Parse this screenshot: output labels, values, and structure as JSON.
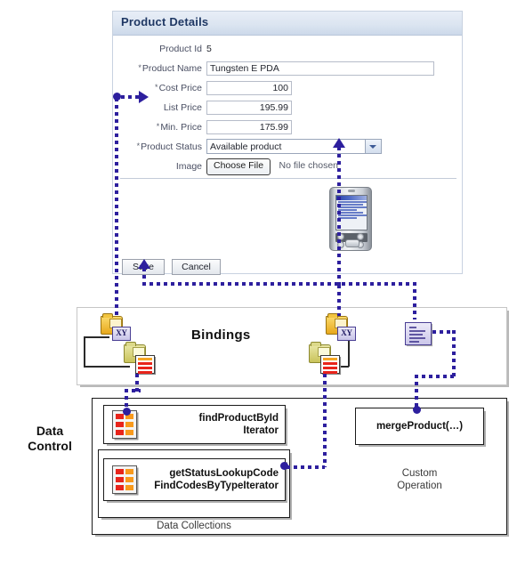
{
  "form": {
    "title": "Product Details",
    "fields": {
      "product_id": {
        "label": "Product Id",
        "value": "5",
        "required": false
      },
      "product_name": {
        "label": "Product Name",
        "value": "Tungsten E PDA",
        "required": true
      },
      "cost_price": {
        "label": "Cost Price",
        "value": "100",
        "required": true
      },
      "list_price": {
        "label": "List Price",
        "value": "195.99",
        "required": false
      },
      "min_price": {
        "label": "Min. Price",
        "value": "175.99",
        "required": true
      },
      "product_status": {
        "label": "Product Status",
        "value": "Available product",
        "required": true
      },
      "image": {
        "label": "Image",
        "button_label": "Choose File",
        "file_status": "No file chosen"
      }
    },
    "required_marker": "*",
    "buttons": {
      "save": "Save",
      "cancel": "Cancel"
    }
  },
  "bindings": {
    "label": "Bindings",
    "icons": {
      "attribute_binding_xy": "XY",
      "list_binding_xy": "XY"
    }
  },
  "data_control": {
    "label": "Data\nControl",
    "label_line1": "Data",
    "label_line2": "Control",
    "collections_label": "Data Collections",
    "custom_operation_label_line1": "Custom",
    "custom_operation_label_line2": "Operation",
    "nodes": [
      {
        "id": "find-product",
        "line1": "findProductById",
        "line2": "Iterator"
      },
      {
        "id": "status-lookup",
        "line1": "getStatusLookupCode",
        "line2": "FindCodesByTypeIterator"
      },
      {
        "id": "merge-product",
        "line1": "mergeProduct(…)"
      }
    ]
  },
  "colors": {
    "connector": "#2d1f9e",
    "header_text": "#1f3864",
    "accent_orange": "#f99a1c",
    "accent_red": "#e8241b"
  }
}
